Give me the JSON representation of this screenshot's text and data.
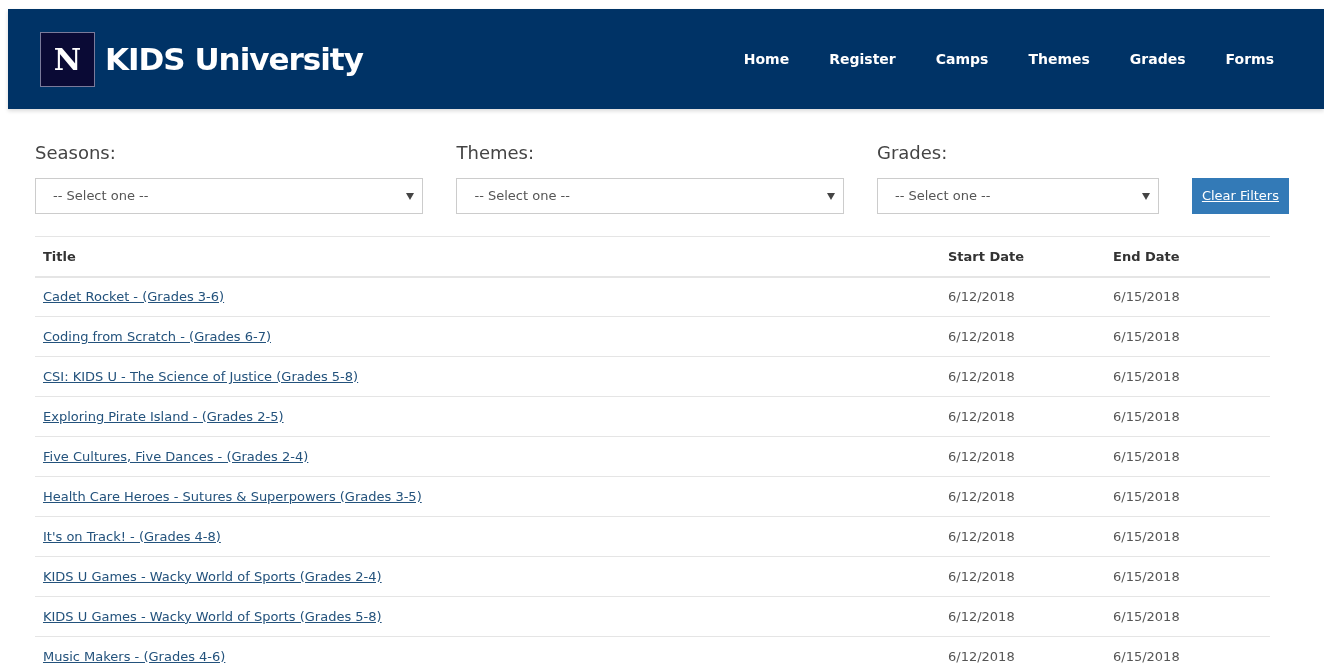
{
  "header": {
    "logo_letter": "N",
    "site_name": "KIDS University",
    "nav": [
      "Home",
      "Register",
      "Camps",
      "Themes",
      "Grades",
      "Forms"
    ]
  },
  "filters": [
    {
      "label": "Seasons:",
      "value": "-- Select one --"
    },
    {
      "label": "Themes:",
      "value": "-- Select one --"
    },
    {
      "label": "Grades:",
      "value": "-- Select one --"
    }
  ],
  "clear_button": "Clear Filters",
  "table": {
    "columns": [
      "Title",
      "Start Date",
      "End Date"
    ],
    "rows": [
      [
        "Cadet Rocket - (Grades 3-6)",
        "6/12/2018",
        "6/15/2018"
      ],
      [
        "Coding from Scratch - (Grades 6-7)",
        "6/12/2018",
        "6/15/2018"
      ],
      [
        "CSI: KIDS U - The Science of Justice (Grades 5-8)",
        "6/12/2018",
        "6/15/2018"
      ],
      [
        "Exploring Pirate Island - (Grades 2-5)",
        "6/12/2018",
        "6/15/2018"
      ],
      [
        "Five Cultures, Five Dances - (Grades 2-4)",
        "6/12/2018",
        "6/15/2018"
      ],
      [
        "Health Care Heroes - Sutures & Superpowers (Grades 3-5)",
        "6/12/2018",
        "6/15/2018"
      ],
      [
        "It's on Track! - (Grades 4-8)",
        "6/12/2018",
        "6/15/2018"
      ],
      [
        "KIDS U Games - Wacky World of Sports (Grades 2-4)",
        "6/12/2018",
        "6/15/2018"
      ],
      [
        "KIDS U Games - Wacky World of Sports (Grades 5-8)",
        "6/12/2018",
        "6/15/2018"
      ],
      [
        "Music Makers - (Grades 4-6)",
        "6/12/2018",
        "6/15/2018"
      ]
    ]
  }
}
